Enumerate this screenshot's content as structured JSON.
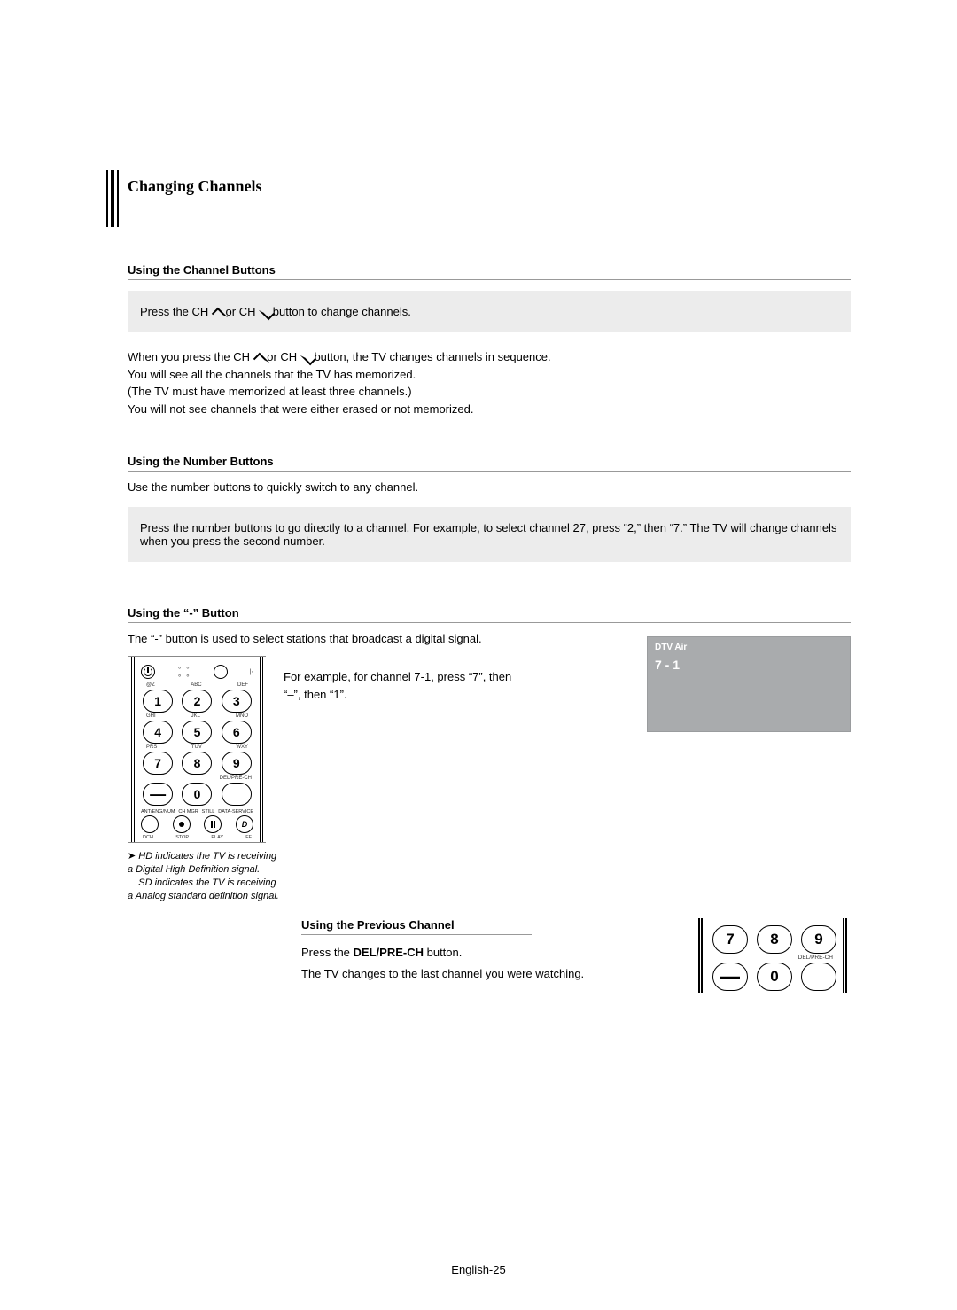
{
  "heading": "Changing Channels",
  "section1": {
    "title": "Using the Channel Buttons",
    "gray_prefix": "Press the CH ",
    "gray_mid": " or CH ",
    "gray_suffix": " button to change channels.",
    "line1_prefix": "When you press the CH ",
    "line1_mid": " or CH ",
    "line1_suffix": " button, the TV changes channels in sequence.",
    "line2": "You will see all the channels that the TV has memorized.",
    "line3": "(The TV must have memorized at least three channels.)",
    "line4": "You will not see channels that were either erased or not memorized."
  },
  "section2": {
    "title": "Using the Number Buttons",
    "lead": "Use the number buttons to quickly switch to any channel.",
    "gray": "Press the number buttons to go directly to a channel. For example, to select channel 27, press “2,” then “7.” The TV will change channels when you press the second number."
  },
  "section3": {
    "title": "Using the “-” Button",
    "lead": "The “-” button is used to select stations that broadcast a digital signal.",
    "example": "For example, for channel 7-1, press “7”, then “–”, then “1”."
  },
  "remote": {
    "top_labels": {
      "left": "@Z",
      "mid": "ABC",
      "right": "DEF"
    },
    "row2_labels": {
      "left": "GHI",
      "mid": "JKL",
      "right": "MNO"
    },
    "row3_labels": {
      "left": "PRS",
      "mid": "TUV",
      "right": "WXY"
    },
    "del_label": "DEL/PRE-CH",
    "under4": "ANT/ENG/NUM",
    "under4b": "CH MGR",
    "under4c": "STILL",
    "under4d": "DATA-SERVICE",
    "bottom": {
      "a": "DCH",
      "b": "STOP",
      "c": "PLAY",
      "d": "FF"
    },
    "numbers": [
      "1",
      "2",
      "3",
      "4",
      "5",
      "6",
      "7",
      "8",
      "9",
      "0"
    ],
    "dash": "—",
    "d_btn": "D"
  },
  "tv": {
    "hdr": "DTV Air",
    "channel": "7 - 1"
  },
  "footnote": {
    "line1": "HD indicates the TV is receiving a Digital High Definition signal.",
    "line2": "SD indicates the TV is receiving a Analog standard definition signal."
  },
  "section4": {
    "title": "Using the Previous Channel",
    "line1_prefix": "Press the ",
    "line1_bold": "DEL/PRE-CH",
    "line1_suffix": " button.",
    "line2": "The TV changes to the last channel you were watching."
  },
  "prev_remote": {
    "numbers": [
      "7",
      "8",
      "9",
      "0"
    ],
    "dash": "—",
    "del_label": "DEL/PRE-CH"
  },
  "page_number": "English-25"
}
